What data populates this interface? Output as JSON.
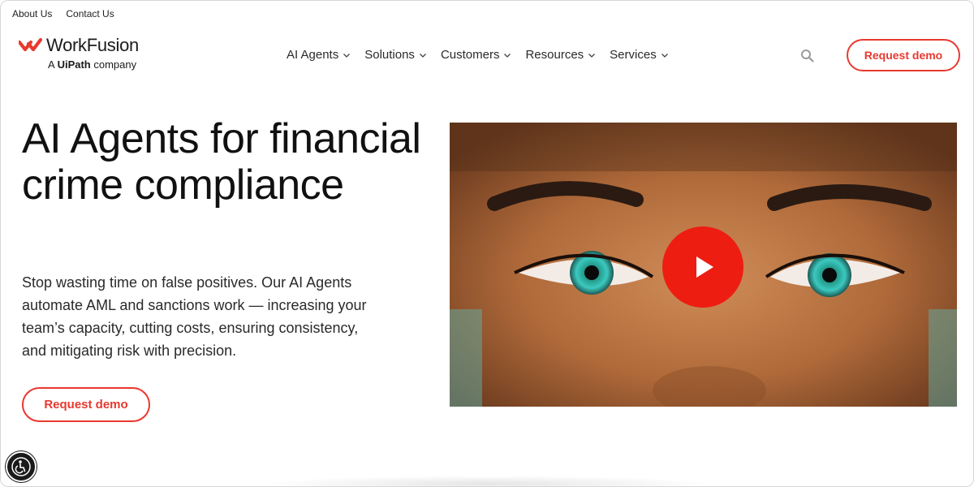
{
  "utility_bar": {
    "about": "About Us",
    "contact": "Contact Us"
  },
  "logo": {
    "wordmark": "WorkFusion",
    "tagline_prefix": "A ",
    "tagline_brand": "UiPath",
    "tagline_suffix": " company"
  },
  "nav": [
    {
      "label": "AI Agents",
      "icon": "chevron-down-icon"
    },
    {
      "label": "Solutions",
      "icon": "chevron-down-icon"
    },
    {
      "label": "Customers",
      "icon": "chevron-down-icon"
    },
    {
      "label": "Resources",
      "icon": "chevron-down-icon"
    },
    {
      "label": "Services",
      "icon": "chevron-down-icon"
    }
  ],
  "header": {
    "search_icon": "search-icon",
    "cta": "Request demo"
  },
  "hero": {
    "title": "AI Agents for financial crime compliance",
    "copy": "Stop wasting time on false positives. Our AI Agents automate AML and sanctions work — increasing your team’s capacity, cutting costs, ensuring consistency, and mitigating risk with precision.",
    "cta": "Request demo"
  },
  "video": {
    "play_icon": "play-icon"
  },
  "accessibility": {
    "icon": "accessibility-icon"
  },
  "colors": {
    "accent": "#e8392f",
    "play": "#ee1d12"
  }
}
